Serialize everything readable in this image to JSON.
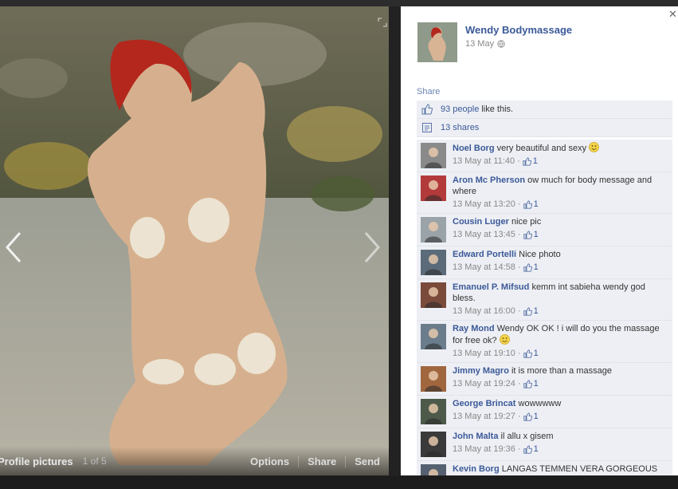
{
  "photo": {
    "album_label": "Profile pictures",
    "position_text": "1 of 5",
    "actions": [
      "Options",
      "Share",
      "Send"
    ]
  },
  "owner": {
    "name": "Wendy Bodymassage",
    "date": "13 May"
  },
  "share_label": "Share",
  "likes": {
    "link": "93 people",
    "text": "like this."
  },
  "shares": {
    "link": "13 shares"
  },
  "comments": [
    {
      "name": "Noel Borg",
      "text": "very beautiful and sexy",
      "smiley": true,
      "time": "13 May at 11:40",
      "likes": "1",
      "avatar_color": "#8a8a8a"
    },
    {
      "name": "Aron Mc Pherson",
      "text": "ow much for body message and where",
      "smiley": false,
      "time": "13 May at 13:20",
      "likes": "1",
      "avatar_color": "#b23a3a"
    },
    {
      "name": "Cousin Luger",
      "text": "nice pic",
      "smiley": false,
      "time": "13 May at 13:45",
      "likes": "1",
      "avatar_color": "#9aa3a8"
    },
    {
      "name": "Edward Portelli",
      "text": "Nice photo",
      "smiley": false,
      "time": "13 May at 14:58",
      "likes": "1",
      "avatar_color": "#5b6b7a"
    },
    {
      "name": "Emanuel P. Mifsud",
      "text": "kemm int sabieha wendy god bless.",
      "smiley": false,
      "time": "13 May at 16:00",
      "likes": "1",
      "avatar_color": "#7a4a3a"
    },
    {
      "name": "Ray Mond",
      "text": "Wendy OK OK ! i will do you the massage for free ok?",
      "smiley": true,
      "time": "13 May at 19:10",
      "likes": "1",
      "avatar_color": "#6b7d8c"
    },
    {
      "name": "Jimmy Magro",
      "text": "it is more than a massage",
      "smiley": false,
      "time": "13 May at 19:24",
      "likes": "1",
      "avatar_color": "#a0673f"
    },
    {
      "name": "George Brincat",
      "text": "wowwwww",
      "smiley": false,
      "time": "13 May at 19:27",
      "likes": "1",
      "avatar_color": "#4d5a4a"
    },
    {
      "name": "John Malta",
      "text": "il allu x gisem",
      "smiley": false,
      "time": "13 May at 19:36",
      "likes": "1",
      "avatar_color": "#3a3a3a"
    },
    {
      "name": "Kevin Borg",
      "text": "LANGAS TEMMEN VERA GORGEOUS",
      "smiley": false,
      "time": "",
      "likes": "",
      "avatar_color": "#556070"
    }
  ],
  "colors": {
    "link": "#3b5998",
    "ufi_bg": "#edeff4",
    "stage_bg": "#3a3a34"
  }
}
